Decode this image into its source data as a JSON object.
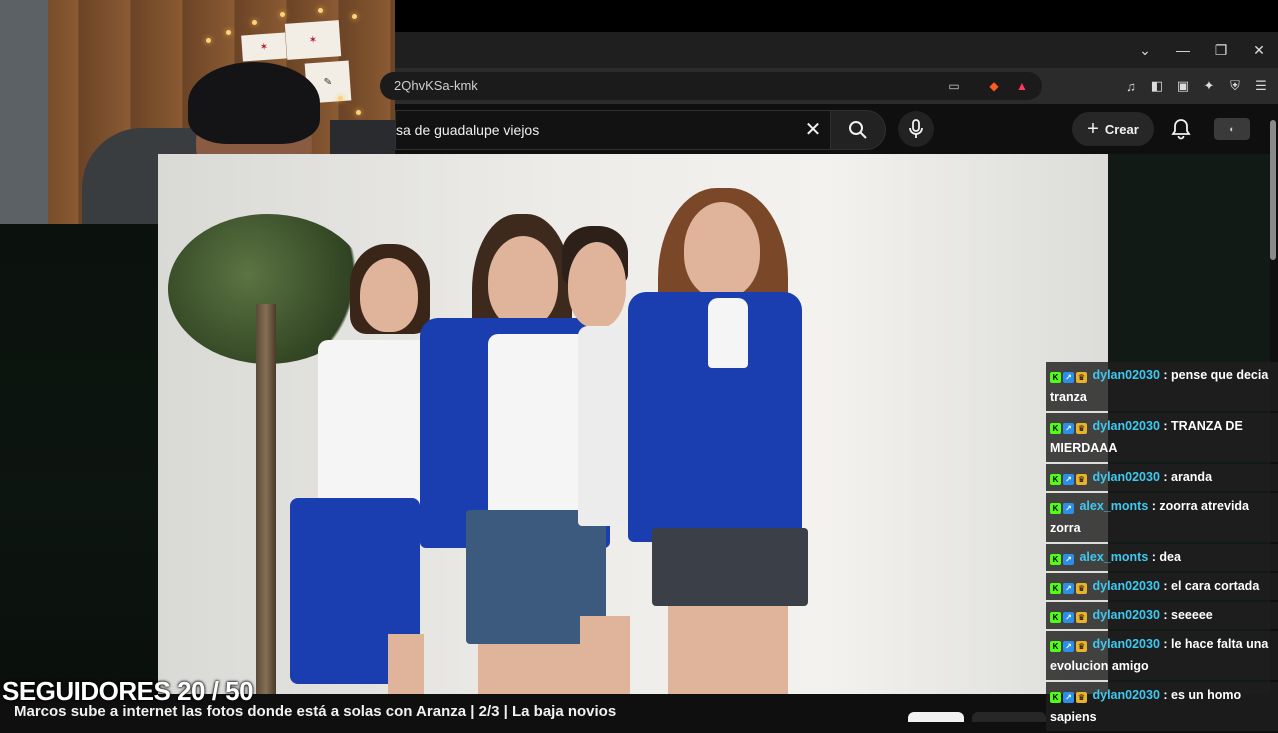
{
  "browser": {
    "url_fragment": "2QhvKSa-kmk",
    "window_controls": [
      "chevron-down-icon",
      "minimize-icon",
      "restore-icon",
      "close-icon"
    ]
  },
  "youtube": {
    "search_value": "sa de guadalupe viejos",
    "create_label": "Crear",
    "title": "Marcos sube a internet las fotos donde está a solas con Aranza | 2/3 | La baja novios"
  },
  "overlay": {
    "followers": "SEGUIDORES 20 / 50"
  },
  "chat": [
    {
      "user": "dylan02030",
      "text": ": pense que decia tranza",
      "badges": [
        "k",
        "s",
        "c"
      ]
    },
    {
      "user": "dylan02030",
      "text": ": TRANZA DE MIERDAAA",
      "badges": [
        "k",
        "s",
        "c"
      ]
    },
    {
      "user": "dylan02030",
      "text": ": aranda",
      "badges": [
        "k",
        "s",
        "c"
      ]
    },
    {
      "user": "alex_monts",
      "text": ": zoorra atrevida zorra",
      "badges": [
        "k",
        "s"
      ]
    },
    {
      "user": "alex_monts",
      "text": ": dea",
      "badges": [
        "k",
        "s"
      ]
    },
    {
      "user": "dylan02030",
      "text": ": el cara cortada",
      "badges": [
        "k",
        "s",
        "c"
      ]
    },
    {
      "user": "dylan02030",
      "text": ": seeeee",
      "badges": [
        "k",
        "s",
        "c"
      ]
    },
    {
      "user": "dylan02030",
      "text": ": le hace falta una evolucion amigo",
      "badges": [
        "k",
        "s",
        "c"
      ]
    },
    {
      "user": "dylan02030",
      "text": ": es un homo sapiens",
      "badges": [
        "k",
        "s",
        "c"
      ]
    }
  ],
  "colors": {
    "kick_green": "#53fc18",
    "chat_username": "#3ec9f0",
    "cardigan_blue": "#1a3db0"
  }
}
